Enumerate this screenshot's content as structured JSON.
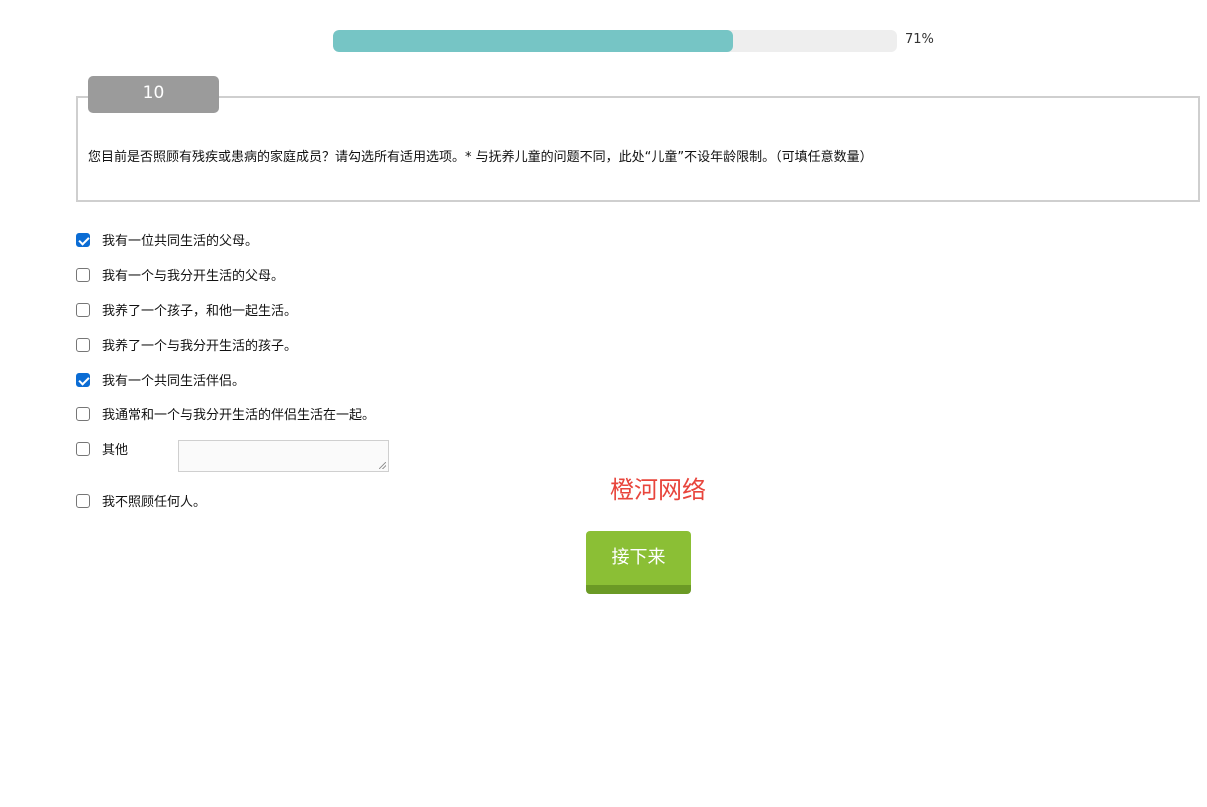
{
  "progress": {
    "value": 71,
    "label": "71%"
  },
  "question": {
    "number": "10",
    "text": "您目前是否照顾有残疾或患病的家庭成员？请勾选所有适用选项。* 与抚养儿童的问题不同，此处“儿童”不设年龄限制。（可填任意数量）"
  },
  "options": [
    {
      "label": "我有一位共同生活的父母。",
      "checked": true
    },
    {
      "label": "我有一个与我分开生活的父母。",
      "checked": false
    },
    {
      "label": "我养了一个孩子，和他一起生活。",
      "checked": false
    },
    {
      "label": "我养了一个与我分开生活的孩子。",
      "checked": false
    },
    {
      "label": "我有一个共同生活伴侣。",
      "checked": true
    },
    {
      "label": "我通常和一个与我分开生活的伴侣生活在一起。",
      "checked": false
    },
    {
      "label": "其他",
      "checked": false
    },
    {
      "label": "我不照顾任何人。",
      "checked": false
    }
  ],
  "other_input": {
    "value": ""
  },
  "watermark": "橙河网络",
  "next_button": {
    "label": "接下来"
  },
  "colors": {
    "progress_fill": "#76c5c5",
    "checkbox_checked": "#0b6cd4",
    "button": "#8bbf35",
    "watermark": "#e8453c"
  }
}
